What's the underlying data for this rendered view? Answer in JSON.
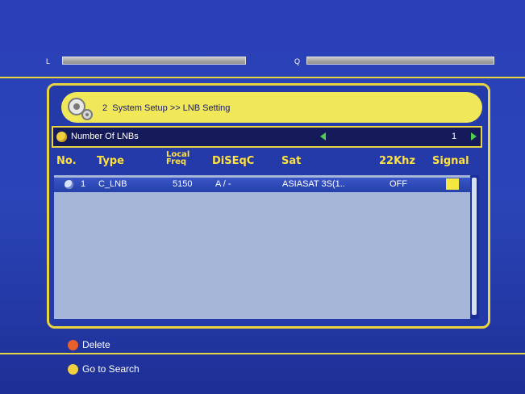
{
  "meters": {
    "left_label": "L",
    "right_label": "Q"
  },
  "header": {
    "number": "2",
    "title": "System Setup >> LNB Setting"
  },
  "lnb": {
    "label": "Number Of LNBs",
    "count": "1"
  },
  "columns": {
    "no": "No.",
    "type": "Type",
    "local_freq_line1": "Local",
    "local_freq_line2": "Freq",
    "diseqc": "DiSEqC",
    "sat": "Sat",
    "khz": "22Khz",
    "signal": "Signal"
  },
  "rows": [
    {
      "no": "1",
      "type": "C_LNB",
      "freq": "5150",
      "diseqc": "A / -",
      "sat": "ASIASAT 3S(1..",
      "khz": "OFF"
    }
  ],
  "footer": {
    "delete_label": "Delete",
    "search_label": "Go to Search"
  },
  "colors": {
    "accent": "#e8d440",
    "background": "#2a45b8",
    "delete_dot": "#e8602c",
    "search_dot": "#f0d040"
  }
}
